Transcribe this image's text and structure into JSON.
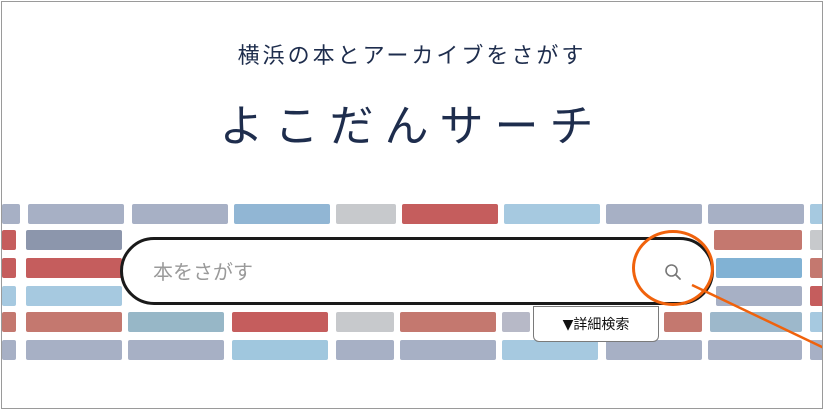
{
  "header": {
    "tagline": "横浜の本とアーカイブをさがす",
    "logo": "よこだんサーチ"
  },
  "search": {
    "placeholder": "本をさがす",
    "value": "",
    "button_icon": "search-icon"
  },
  "advanced_search": {
    "label": "▼詳細検索"
  },
  "annotation": {
    "color": "#f0620c"
  },
  "colors": {
    "brand_text": "#1e2d4d",
    "stripe_red": "#c95c5c",
    "stripe_blue": "#9ec7e0",
    "stripe_slate": "#a7b0c6",
    "stripe_grey": "#c7c9cc"
  }
}
